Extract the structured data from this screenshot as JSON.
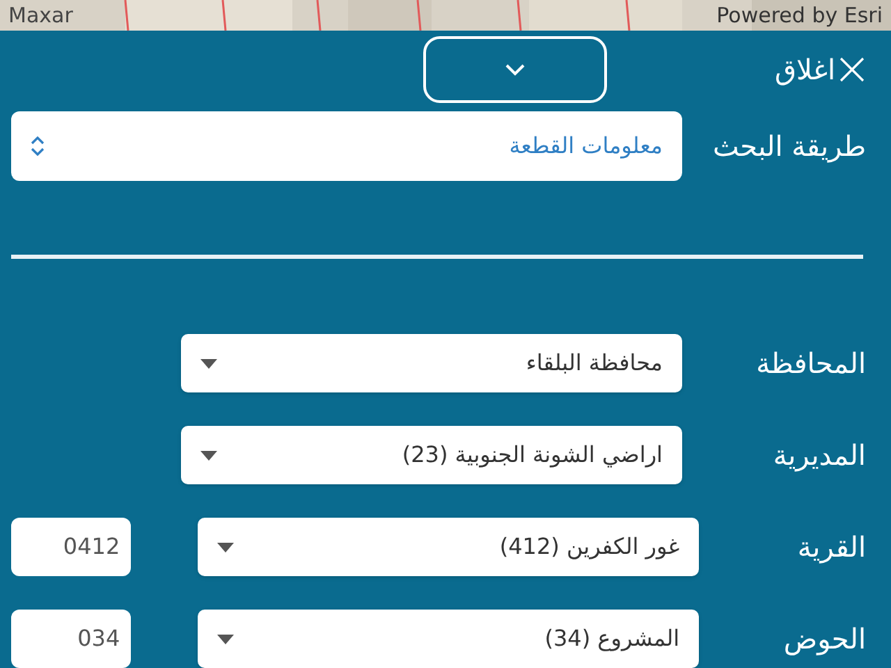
{
  "map": {
    "attribution_left": "Maxar",
    "attribution_right": "Powered by Esri"
  },
  "header": {
    "close_label": "اغلاق"
  },
  "search_method": {
    "label": "طريقة البحث",
    "value": "معلومات القطعة"
  },
  "fields": [
    {
      "label": "المحافظة",
      "value": "محافظة البلقاء"
    },
    {
      "label": "المديرية",
      "value": "اراضي الشونة الجنوبية (23)"
    },
    {
      "label": "القرية",
      "value": "غور الكفرين (412)",
      "code": "0412"
    },
    {
      "label": "الحوض",
      "value": "المشروع (34)",
      "code": "034"
    }
  ]
}
